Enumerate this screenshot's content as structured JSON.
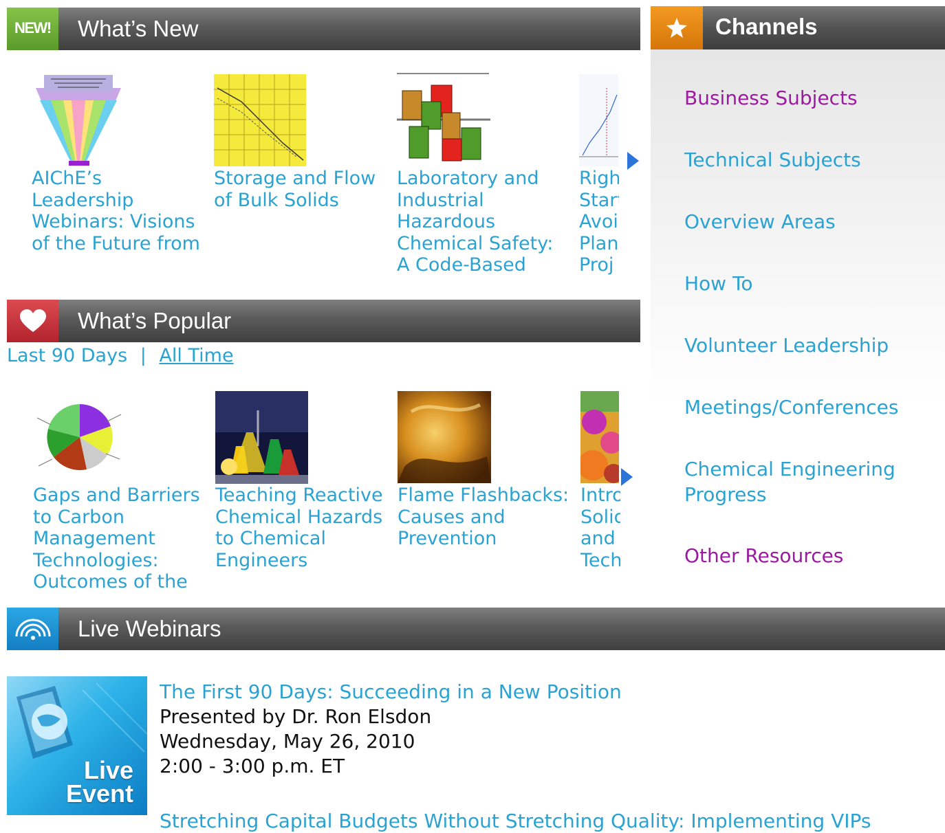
{
  "whats_new": {
    "badge": "NEW!",
    "title": "What’s New",
    "items": [
      {
        "caption": "AIChE’s Leadership Webinars: Visions of the Future from"
      },
      {
        "caption": "Storage and Flow of Bulk Solids"
      },
      {
        "caption": "Laboratory and Industrial Hazardous Chemical Safety: A Code-Based"
      },
      {
        "caption": "Right Start Avoi Plan Proj"
      }
    ]
  },
  "whats_popular": {
    "title": "What’s Popular",
    "filter_last_90": "Last 90 Days",
    "filter_separator": "|",
    "filter_all_time": "All Time",
    "items": [
      {
        "caption": "Gaps and Barriers to Carbon Management Technologies: Outcomes of the"
      },
      {
        "caption": "Teaching Reactive Chemical Hazards to Chemical Engineers"
      },
      {
        "caption": "Flame Flashbacks: Causes and Prevention"
      },
      {
        "caption": "Intro Solid and Tech"
      }
    ]
  },
  "channels": {
    "title": "Channels",
    "items": [
      {
        "label": "Business Subjects"
      },
      {
        "label": "Technical Subjects"
      },
      {
        "label": "Overview Areas"
      },
      {
        "label": "How To"
      },
      {
        "label": "Volunteer Leadership"
      },
      {
        "label": "Meetings/Conferences"
      },
      {
        "label": "Chemical Engineering Progress"
      },
      {
        "label": "Other Resources"
      }
    ]
  },
  "live_webinars": {
    "title": "Live Webinars",
    "event_image_text_1": "Live",
    "event_image_text_2": "Event",
    "event1": {
      "title": "The First 90 Days: Succeeding in a New Position",
      "presenter": "Presented by Dr. Ron Elsdon",
      "date": "Wednesday, May 26, 2010",
      "time": "2:00 - 3:00 p.m. ET"
    },
    "event2": {
      "title": "Stretching Capital Budgets Without Stretching Quality: Implementing VIPs"
    }
  },
  "colors": {
    "link_blue": "#2aa2d2",
    "visited_purple": "#9b1aa0",
    "new_green": "#6fae3a",
    "popular_red": "#c8323c",
    "channels_orange": "#e58a12",
    "live_blue": "#1e8fd2"
  }
}
